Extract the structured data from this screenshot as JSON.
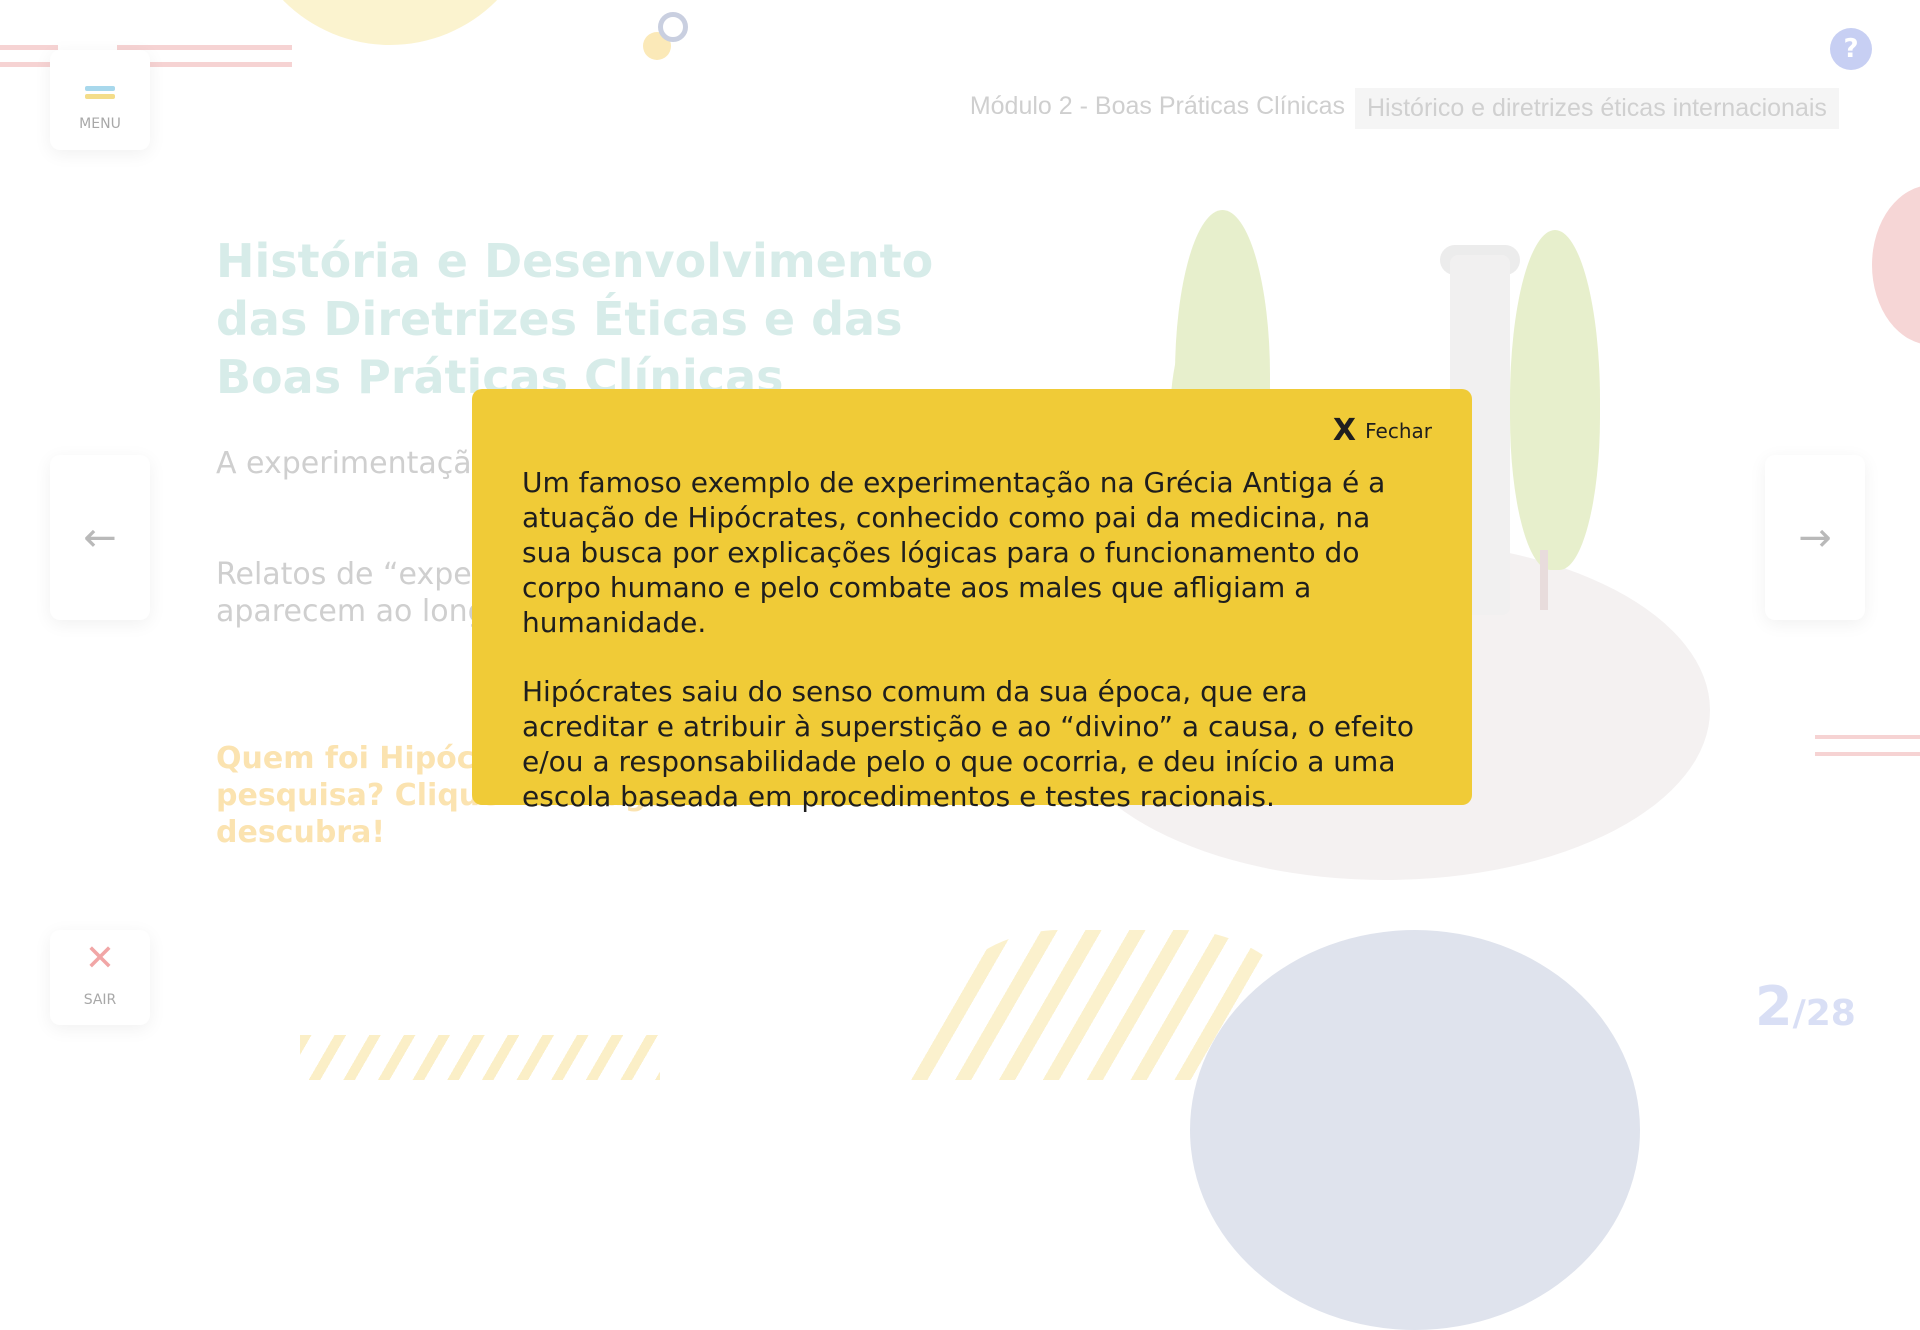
{
  "header": {
    "module_title": "Módulo 2 - Boas Práticas Clínicas",
    "topic_title": "Histórico e diretrizes éticas internacionais"
  },
  "menu": {
    "label": "MENU",
    "bar_colors": [
      "#a8d8ec",
      "#f4dd8a"
    ]
  },
  "exit": {
    "icon": "close-x-icon",
    "label": "SAIR"
  },
  "help": {
    "label": "?"
  },
  "nav": {
    "prev_icon": "←",
    "next_icon": "→"
  },
  "content": {
    "title": "História e Desenvolvimento das Diretrizes Éticas e das Boas Práticas Clínicas",
    "paragraph_1": "A experimentação … desde a antiguidade",
    "paragraph_2": "Relatos de “experi… condição a que se … aparecem ao long… desde a época da",
    "call_to_action": "Quem foi Hipócra… contexto do dese… pesquisa? Clique na imagem e descubra!"
  },
  "modal": {
    "close_icon": "X",
    "close_label": "Fechar",
    "paragraphs": [
      "Um famoso exemplo de experimentação na Grécia Antiga é a atuação de Hipócrates, conhecido como pai da medicina, na sua busca por explicações lógicas para o funcionamento do corpo humano e pelo combate aos males que afligiam a humanidade.",
      "Hipócrates saiu do senso comum da sua época, que era acreditar e atribuir à superstição e ao “divino” a causa, o efeito e/ou a responsabilidade pelo o que ocorria, e deu início a uma escola baseada em procedimentos e testes racionais."
    ]
  },
  "pagination": {
    "current": "2",
    "total": "/28"
  },
  "colors": {
    "modal_bg": "#f0cb37",
    "title": "#d7ece9",
    "cta": "#fbe3b0",
    "help": "#c7cff3"
  }
}
